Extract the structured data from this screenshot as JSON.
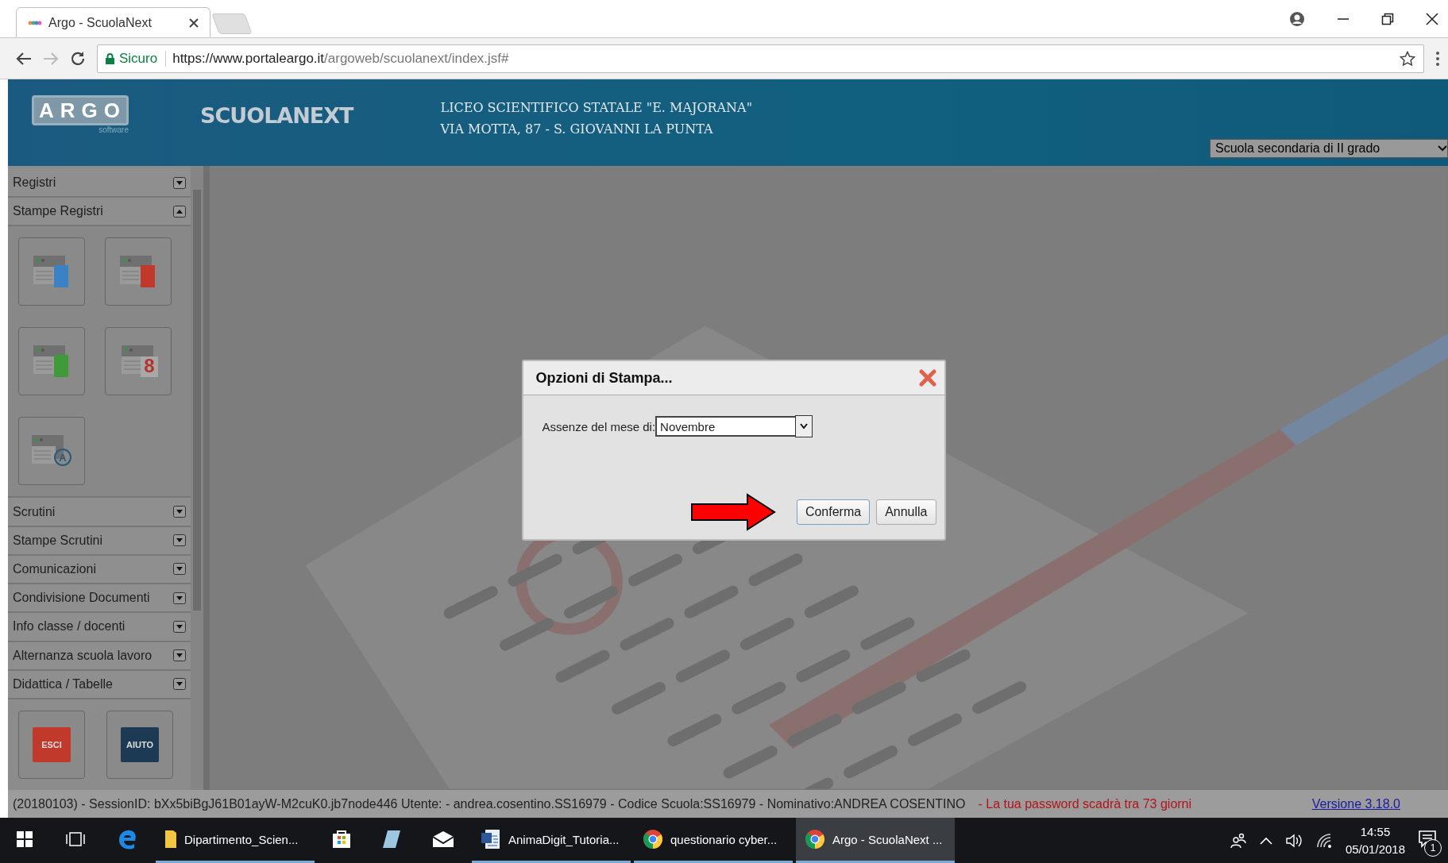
{
  "browser": {
    "tabs": [
      {
        "title": "Argo - ScuolaNext",
        "selected": true
      }
    ],
    "security_label": "Sicuro",
    "url_host": "https://www.portaleargo.it",
    "url_path": "/argoweb/scuolanext/index.jsf#"
  },
  "header": {
    "logo": "ARGO",
    "logo_sub": "software",
    "product": "SCUOLANEXT",
    "school_name": "LICEO SCIENTIFICO STATALE \"E. MAJORANA\"",
    "school_address": "VIA MOTTA, 87 - S. GIOVANNI LA PUNTA",
    "school_type": "Scuola secondaria di II grado"
  },
  "sidebar": {
    "sections": [
      {
        "label": "Registri",
        "expanded": false
      },
      {
        "label": "Stampe Registri",
        "expanded": true,
        "tiles": [
          {
            "kind": "book",
            "color": "#3b82c4"
          },
          {
            "kind": "book",
            "color": "#c0392b"
          },
          {
            "kind": "book",
            "color": "#3f9a3a"
          },
          {
            "kind": "calendar",
            "glyph": "8"
          },
          {
            "kind": "letter",
            "glyph": "A"
          }
        ]
      },
      {
        "label": "Scrutini",
        "expanded": false
      },
      {
        "label": "Stampe Scrutini",
        "expanded": false
      },
      {
        "label": "Comunicazioni",
        "expanded": false
      },
      {
        "label": "Condivisione Documenti",
        "expanded": false
      },
      {
        "label": "Info classe / docenti",
        "expanded": false
      },
      {
        "label": "Alternanza scuola lavoro",
        "expanded": false
      },
      {
        "label": "Didattica / Tabelle",
        "expanded": false
      }
    ],
    "bottom_tiles": [
      {
        "label": "ESCI",
        "color": "#c0392b"
      },
      {
        "label": "AIUTO",
        "color": "#1d3a55"
      }
    ]
  },
  "dialog": {
    "title": "Opzioni di Stampa...",
    "field_label": "Assenze del mese di:",
    "field_value": "Novembre",
    "buttons": [
      {
        "label": "Conferma",
        "default": true
      },
      {
        "label": "Annulla",
        "default": false
      }
    ]
  },
  "status_bar": {
    "session": "(20180103) - SessionID: bXx5biBgJ61B01ayW-M2cuK0.jb7node446 Utente: - andrea.cosentino.SS16979 - Codice Scuola:SS16979 - Nominativo:ANDREA COSENTINO",
    "warning": "- La tua password scadrà tra 73 giorni",
    "version": "Versione 3.18.0"
  },
  "taskbar": {
    "apps": [
      {
        "kind": "windows",
        "running": false,
        "selected": false
      },
      {
        "kind": "taskview",
        "running": false,
        "selected": false
      },
      {
        "kind": "edge",
        "running": false,
        "selected": false
      },
      {
        "kind": "explorer",
        "label": "Dipartimento_Scien...",
        "running": true,
        "selected": false
      },
      {
        "kind": "store",
        "running": false,
        "selected": false
      },
      {
        "kind": "notes",
        "running": false,
        "selected": false
      },
      {
        "kind": "mail",
        "running": false,
        "selected": false
      },
      {
        "kind": "word",
        "label": "AnimaDigit_Tutoria...",
        "running": true,
        "selected": false
      },
      {
        "kind": "chrome",
        "label": "questionario cyber...",
        "running": true,
        "selected": false
      },
      {
        "kind": "chrome",
        "label": "Argo - ScuolaNext ...",
        "running": true,
        "selected": true
      }
    ],
    "time": "14:55",
    "date": "05/01/2018",
    "notifications": "1"
  }
}
